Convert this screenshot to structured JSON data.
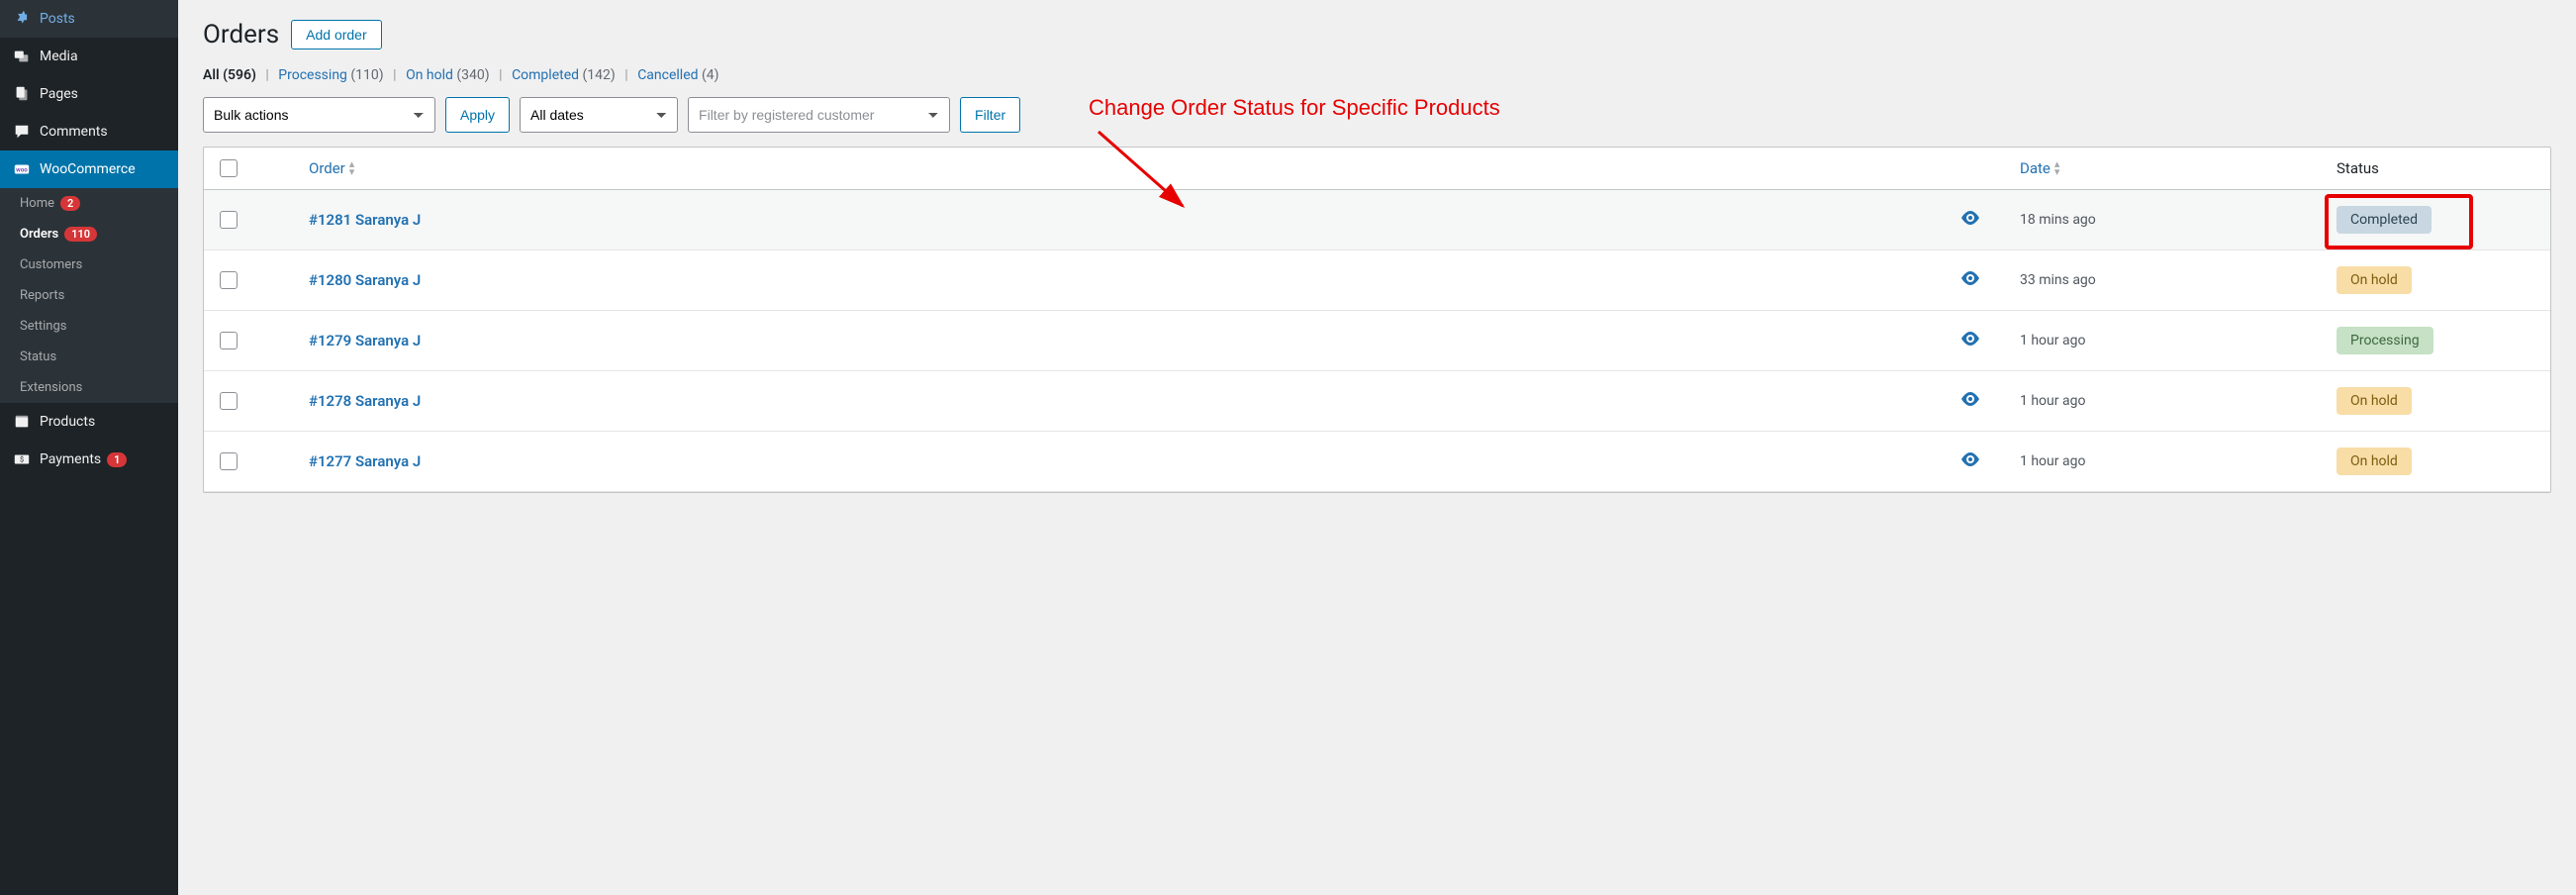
{
  "sidebar": {
    "items": [
      {
        "icon": "pin",
        "label": "Posts"
      },
      {
        "icon": "media",
        "label": "Media"
      },
      {
        "icon": "pages",
        "label": "Pages"
      },
      {
        "icon": "comments",
        "label": "Comments"
      },
      {
        "icon": "woo",
        "label": "WooCommerce",
        "active": true
      },
      {
        "icon": "products",
        "label": "Products"
      },
      {
        "icon": "payments",
        "label": "Payments",
        "badge": "1"
      }
    ],
    "submenu": [
      {
        "label": "Home",
        "badge": "2"
      },
      {
        "label": "Orders",
        "badge": "110",
        "current": true
      },
      {
        "label": "Customers"
      },
      {
        "label": "Reports"
      },
      {
        "label": "Settings"
      },
      {
        "label": "Status"
      },
      {
        "label": "Extensions"
      }
    ]
  },
  "page": {
    "title": "Orders",
    "add_button": "Add order"
  },
  "filters": {
    "all_label": "All",
    "all_count": "(596)",
    "processing_label": "Processing",
    "processing_count": "(110)",
    "onhold_label": "On hold",
    "onhold_count": "(340)",
    "completed_label": "Completed",
    "completed_count": "(142)",
    "cancelled_label": "Cancelled",
    "cancelled_count": "(4)"
  },
  "toolbar": {
    "bulk_actions": "Bulk actions",
    "apply": "Apply",
    "all_dates": "All dates",
    "filter_customer": "Filter by registered customer",
    "filter": "Filter"
  },
  "annotation": {
    "text": "Change Order Status for Specific Products"
  },
  "columns": {
    "order": "Order",
    "date": "Date",
    "status": "Status"
  },
  "orders": [
    {
      "id": "#1281 Saranya J",
      "date": "18 mins ago",
      "status": "Completed",
      "status_class": "completed",
      "highlight": true
    },
    {
      "id": "#1280 Saranya J",
      "date": "33 mins ago",
      "status": "On hold",
      "status_class": "onhold"
    },
    {
      "id": "#1279 Saranya J",
      "date": "1 hour ago",
      "status": "Processing",
      "status_class": "processing"
    },
    {
      "id": "#1278 Saranya J",
      "date": "1 hour ago",
      "status": "On hold",
      "status_class": "onhold"
    },
    {
      "id": "#1277 Saranya J",
      "date": "1 hour ago",
      "status": "On hold",
      "status_class": "onhold"
    }
  ]
}
